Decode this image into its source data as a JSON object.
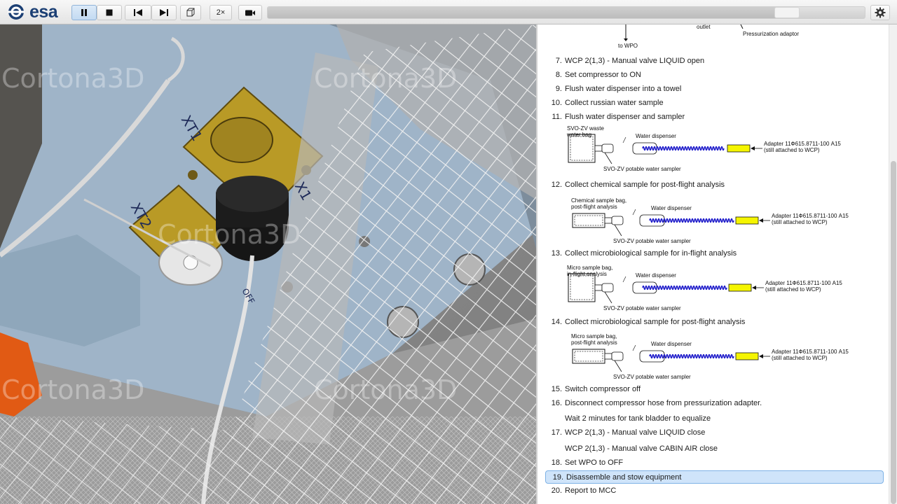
{
  "app": {
    "logo_text": "esa",
    "speed_label": "2×",
    "progress_fraction": 0.87,
    "colors": {
      "highlight_bg": "#cfe4fa",
      "highlight_border": "#7eb2e6",
      "coil": "#1a17c9",
      "adapter_yellow": "#f5f500"
    }
  },
  "toolbar": {
    "buttons": [
      {
        "name": "pause-button",
        "icon": "pause-icon"
      },
      {
        "name": "stop-button",
        "icon": "stop-icon"
      },
      {
        "name": "skip-back-button",
        "icon": "skip-back-icon"
      },
      {
        "name": "skip-forward-button",
        "icon": "skip-forward-icon"
      },
      {
        "name": "view-3d-button",
        "icon": "cube-icon"
      },
      {
        "name": "speed-button",
        "icon": ""
      },
      {
        "name": "camera-button",
        "icon": "video-camera-icon"
      },
      {
        "name": "settings-button",
        "icon": "gear-icon"
      }
    ]
  },
  "viewport": {
    "watermark": "Cortona3D",
    "labels": {
      "xt1": "XT1",
      "x1": "X1",
      "xt2": "XT2",
      "off": "OFF"
    }
  },
  "procedure": {
    "top_diagram": {
      "outlet": "outlet",
      "pressurization": "Pressurization adaptor",
      "to_wpo": "to WPO"
    },
    "steps": [
      {
        "num": "7.",
        "text": "WCP 2(1,3) - Manual valve LIQUID open"
      },
      {
        "num": "8.",
        "text": "Set compressor to ON"
      },
      {
        "num": "9.",
        "text": "Flush water dispenser into a towel"
      },
      {
        "num": "10.",
        "text": "Collect russian water sample"
      },
      {
        "num": "11.",
        "text": "Flush water dispenser and sampler"
      },
      {
        "num": "12.",
        "text": "Collect chemical sample for post-flight analysis"
      },
      {
        "num": "13.",
        "text": "Collect microbiological sample for in-flight analysis"
      },
      {
        "num": "14.",
        "text": "Collect microbiological sample for post-flight analysis"
      },
      {
        "num": "15.",
        "text": "Switch compressor off"
      },
      {
        "num": "16.",
        "text": "Disconnect compressor hose from pressurization adapter."
      },
      {
        "num": "",
        "text": "Wait 2 minutes for tank bladder to equalize"
      },
      {
        "num": "17.",
        "text": "WCP 2(1,3) - Manual valve LIQUID close"
      },
      {
        "num": "",
        "text": "WCP 2(1,3) - Manual valve CABIN AIR close"
      },
      {
        "num": "18.",
        "text": "Set WPO to OFF"
      },
      {
        "num": "19.",
        "text": "Disassemble and stow equipment"
      },
      {
        "num": "20.",
        "text": "Report to MCC"
      }
    ],
    "active_step": "19.",
    "diagrams": [
      {
        "bag1": "SVO-ZV waste",
        "bag2": "water bag",
        "dispenser": "Water dispenser",
        "sampler": "SVO-ZV potable water sampler",
        "adapter1": "Adapter 11Ф615.8711-100 A15",
        "adapter2": "(still attached to WCP)"
      },
      {
        "bag1": "Chemical sample bag,",
        "bag2": "post-flight analysis",
        "dispenser": "Water dispenser",
        "sampler": "SVO-ZV potable water sampler",
        "adapter1": "Adapter 11Ф615.8711-100 A15",
        "adapter2": "(still attached to WCP)"
      },
      {
        "bag1": "Micro sample bag,",
        "bag2": "in-flight analysis",
        "dispenser": "Water dispenser",
        "sampler": "SVO-ZV potable water sampler",
        "adapter1": "Adapter 11Ф615.8711-100 A15",
        "adapter2": "(still attached to WCP)"
      },
      {
        "bag1": "Micro sample bag,",
        "bag2": "post-flight analysis",
        "dispenser": "Water dispenser",
        "sampler": "SVO-ZV potable water sampler",
        "adapter1": "Adapter 11Ф615.8711-100 A15",
        "adapter2": "(still attached to WCP)"
      }
    ]
  }
}
